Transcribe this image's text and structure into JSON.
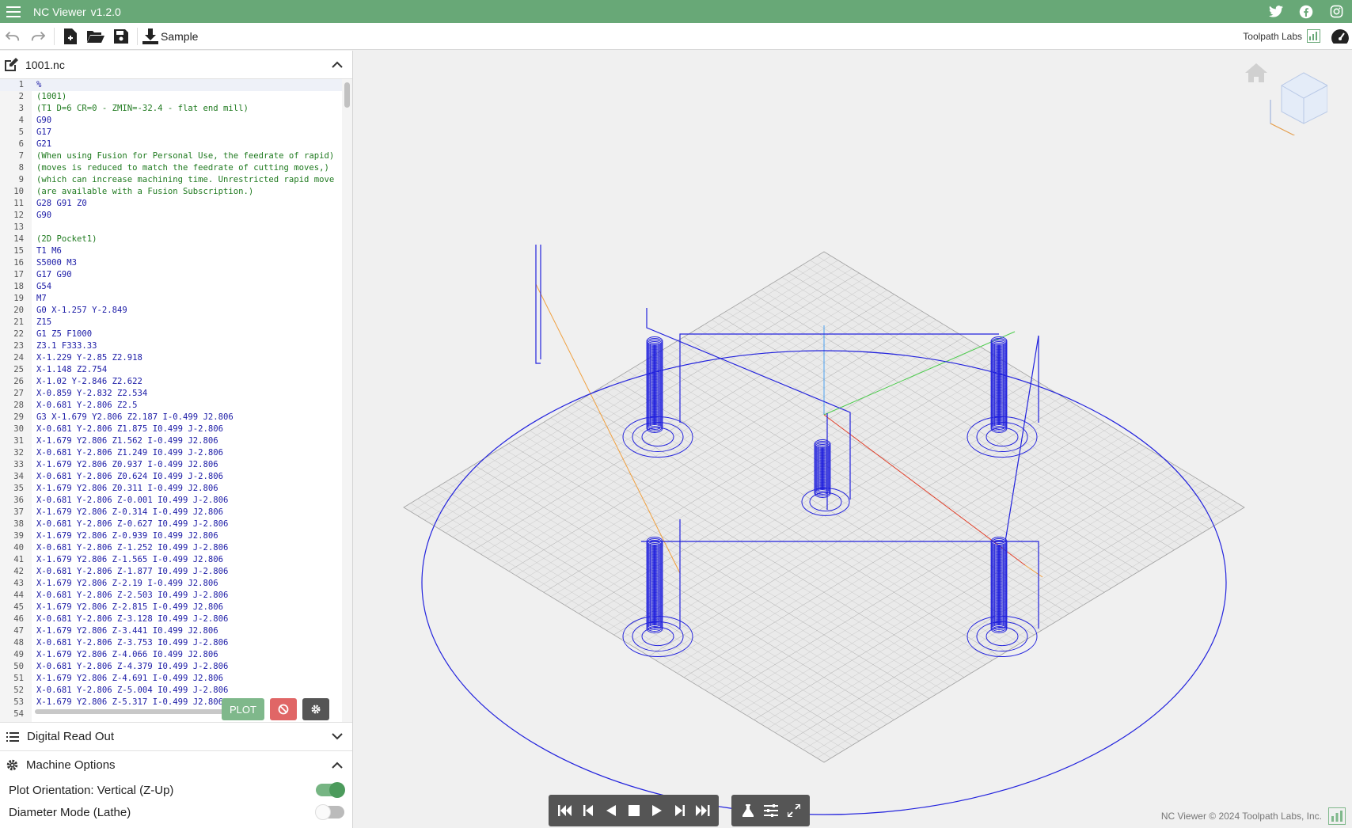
{
  "app": {
    "title": "NC Viewer",
    "version": "v1.2.0",
    "brand": "#68a877"
  },
  "social": [
    {
      "name": "twitter-icon"
    },
    {
      "name": "facebook-icon"
    },
    {
      "name": "instagram-icon"
    }
  ],
  "toolbar": {
    "sample_label": "Sample",
    "brand_label": "Toolpath Labs"
  },
  "file": {
    "name": "1001.nc"
  },
  "code": {
    "lines": [
      {
        "n": "1",
        "t": "%"
      },
      {
        "n": "2",
        "t": "(1001)"
      },
      {
        "n": "3",
        "t": "(T1 D=6 CR=0 - ZMIN=-32.4 - flat end mill)"
      },
      {
        "n": "4",
        "t": "G90"
      },
      {
        "n": "5",
        "t": "G17"
      },
      {
        "n": "6",
        "t": "G21"
      },
      {
        "n": "7",
        "t": "(When using Fusion for Personal Use, the feedrate of rapid)"
      },
      {
        "n": "8",
        "t": "(moves is reduced to match the feedrate of cutting moves,)"
      },
      {
        "n": "9",
        "t": "(which can increase machining time. Unrestricted rapid move"
      },
      {
        "n": "10",
        "t": "(are available with a Fusion Subscription.)"
      },
      {
        "n": "11",
        "t": "G28 G91 Z0"
      },
      {
        "n": "12",
        "t": "G90"
      },
      {
        "n": "13",
        "t": ""
      },
      {
        "n": "14",
        "t": "(2D Pocket1)"
      },
      {
        "n": "15",
        "t": "T1 M6"
      },
      {
        "n": "16",
        "t": "S5000 M3"
      },
      {
        "n": "17",
        "t": "G17 G90"
      },
      {
        "n": "18",
        "t": "G54"
      },
      {
        "n": "19",
        "t": "M7"
      },
      {
        "n": "20",
        "t": "G0 X-1.257 Y-2.849"
      },
      {
        "n": "21",
        "t": "Z15"
      },
      {
        "n": "22",
        "t": "G1 Z5 F1000"
      },
      {
        "n": "23",
        "t": "Z3.1 F333.33"
      },
      {
        "n": "24",
        "t": "X-1.229 Y-2.85 Z2.918"
      },
      {
        "n": "25",
        "t": "X-1.148 Z2.754"
      },
      {
        "n": "26",
        "t": "X-1.02 Y-2.846 Z2.622"
      },
      {
        "n": "27",
        "t": "X-0.859 Y-2.832 Z2.534"
      },
      {
        "n": "28",
        "t": "X-0.681 Y-2.806 Z2.5"
      },
      {
        "n": "29",
        "t": "G3 X-1.679 Y2.806 Z2.187 I-0.499 J2.806"
      },
      {
        "n": "30",
        "t": "X-0.681 Y-2.806 Z1.875 I0.499 J-2.806"
      },
      {
        "n": "31",
        "t": "X-1.679 Y2.806 Z1.562 I-0.499 J2.806"
      },
      {
        "n": "32",
        "t": "X-0.681 Y-2.806 Z1.249 I0.499 J-2.806"
      },
      {
        "n": "33",
        "t": "X-1.679 Y2.806 Z0.937 I-0.499 J2.806"
      },
      {
        "n": "34",
        "t": "X-0.681 Y-2.806 Z0.624 I0.499 J-2.806"
      },
      {
        "n": "35",
        "t": "X-1.679 Y2.806 Z0.311 I-0.499 J2.806"
      },
      {
        "n": "36",
        "t": "X-0.681 Y-2.806 Z-0.001 I0.499 J-2.806"
      },
      {
        "n": "37",
        "t": "X-1.679 Y2.806 Z-0.314 I-0.499 J2.806"
      },
      {
        "n": "38",
        "t": "X-0.681 Y-2.806 Z-0.627 I0.499 J-2.806"
      },
      {
        "n": "39",
        "t": "X-1.679 Y2.806 Z-0.939 I0.499 J2.806"
      },
      {
        "n": "40",
        "t": "X-0.681 Y-2.806 Z-1.252 I0.499 J-2.806"
      },
      {
        "n": "41",
        "t": "X-1.679 Y2.806 Z-1.565 I-0.499 J2.806"
      },
      {
        "n": "42",
        "t": "X-0.681 Y-2.806 Z-1.877 I0.499 J-2.806"
      },
      {
        "n": "43",
        "t": "X-1.679 Y2.806 Z-2.19 I-0.499 J2.806"
      },
      {
        "n": "44",
        "t": "X-0.681 Y-2.806 Z-2.503 I0.499 J-2.806"
      },
      {
        "n": "45",
        "t": "X-1.679 Y2.806 Z-2.815 I-0.499 J2.806"
      },
      {
        "n": "46",
        "t": "X-0.681 Y-2.806 Z-3.128 I0.499 J-2.806"
      },
      {
        "n": "47",
        "t": "X-1.679 Y2.806 Z-3.441 I0.499 J2.806"
      },
      {
        "n": "48",
        "t": "X-0.681 Y-2.806 Z-3.753 I0.499 J-2.806"
      },
      {
        "n": "49",
        "t": "X-1.679 Y2.806 Z-4.066 I0.499 J2.806"
      },
      {
        "n": "50",
        "t": "X-0.681 Y-2.806 Z-4.379 I0.499 J-2.806"
      },
      {
        "n": "51",
        "t": "X-1.679 Y2.806 Z-4.691 I-0.499 J2.806"
      },
      {
        "n": "52",
        "t": "X-0.681 Y-2.806 Z-5.004 I0.499 J-2.806"
      },
      {
        "n": "53",
        "t": "X-1.679 Y2.806 Z-5.317 I-0.499 J2.806"
      },
      {
        "n": "54",
        "t": ""
      }
    ]
  },
  "editor_buttons": {
    "plot_label": "PLOT"
  },
  "sections": {
    "dro_label": "Digital Read Out",
    "machine_label": "Machine Options"
  },
  "options": [
    {
      "label": "Plot Orientation: Vertical (Z-Up)",
      "on": true
    },
    {
      "label": "Diameter Mode (Lathe)",
      "on": false
    }
  ],
  "footer": {
    "copyright": "NC Viewer © 2024 Toolpath Labs, Inc."
  }
}
